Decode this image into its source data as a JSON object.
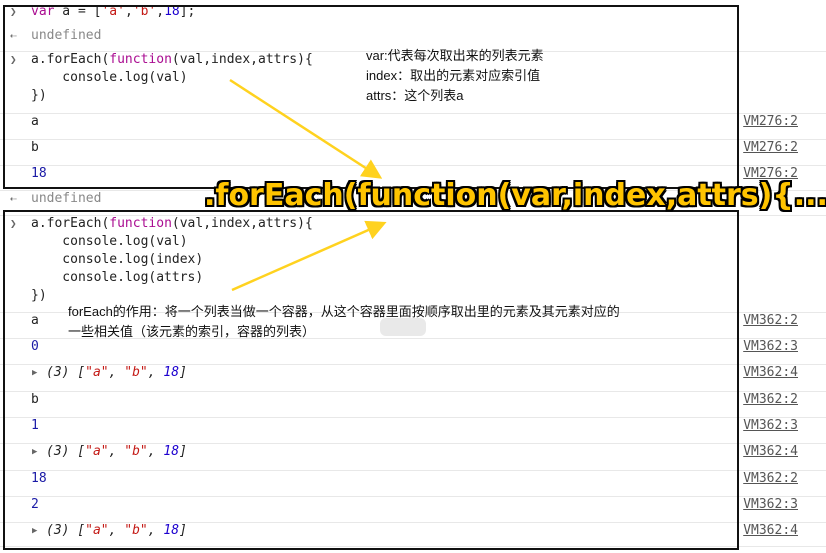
{
  "console": {
    "lines": [
      {
        "type": "input",
        "text": "var a = ['a','b',18];"
      },
      {
        "type": "result",
        "text": "undefined"
      },
      {
        "type": "input",
        "text": "a.forEach(function(val,index,attrs){"
      },
      {
        "type": "cont",
        "text": "    console.log(val)"
      },
      {
        "type": "cont",
        "text": "})"
      },
      {
        "type": "log",
        "text": "a",
        "source": "VM276:2"
      },
      {
        "type": "log",
        "text": "b",
        "source": "VM276:2"
      },
      {
        "type": "log",
        "text": "18",
        "source": "VM276:2"
      },
      {
        "type": "result",
        "text": "undefined"
      },
      {
        "type": "input",
        "text": "a.forEach(function(val,index,attrs){"
      },
      {
        "type": "cont",
        "text": "    console.log(val)"
      },
      {
        "type": "cont",
        "text": "    console.log(index)"
      },
      {
        "type": "cont",
        "text": "    console.log(attrs)"
      },
      {
        "type": "cont",
        "text": "})"
      },
      {
        "type": "log",
        "text": "a",
        "source": "VM362:2"
      },
      {
        "type": "log",
        "text": "0",
        "source": "VM362:3"
      },
      {
        "type": "array",
        "text": "(3) [\"a\", \"b\", 18]",
        "source": "VM362:4"
      },
      {
        "type": "log",
        "text": "b",
        "source": "VM362:2"
      },
      {
        "type": "log",
        "text": "1",
        "source": "VM362:3"
      },
      {
        "type": "array",
        "text": "(3) [\"a\", \"b\", 18]",
        "source": "VM362:4"
      },
      {
        "type": "log",
        "text": "18",
        "source": "VM362:2"
      },
      {
        "type": "log",
        "text": "2",
        "source": "VM362:3"
      },
      {
        "type": "array",
        "text": "(3) [\"a\", \"b\", 18]",
        "source": "VM362:4"
      }
    ]
  },
  "annotations": {
    "note1_line1": "var:代表每次取出来的列表元素",
    "note1_line2": "index：取出的元素对应索引值",
    "note1_line3": "attrs：这个列表a",
    "big_title": ".forEach(function(var,index,attrs){...})",
    "note2_line1": "forEach的作用：将一个列表当做一个容器，从这个容器里面按顺序取出里的元素及其元素对应的",
    "note2_line2": "一些相关值（该元素的索引，容器的列表）"
  },
  "colors": {
    "arrow": "#ffd21f",
    "title_fill": "#ffc400",
    "title_outline": "#000000"
  }
}
